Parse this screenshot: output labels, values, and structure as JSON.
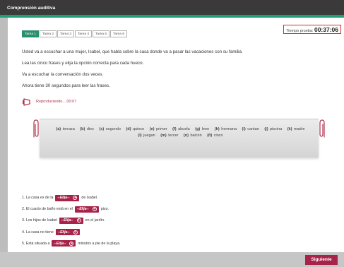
{
  "window": {
    "title": "Comprensión auditiva"
  },
  "tabs": [
    "Tarea 1",
    "Tarea 2",
    "Tarea 3",
    "Tarea 4",
    "Tarea 5",
    "Tarea 6"
  ],
  "active_tab": 0,
  "timer": {
    "label": "Tiempo prueba:",
    "value": "00:37:06"
  },
  "instructions": [
    "Usted va a escuchar a una mujer, Isabel, que habla sobre la casa donde va a pasar las vacaciones con su familia.",
    "Lea las cinco frases y elija la opción correcta para cada hueco.",
    "Va a escuchar la conversación dos veces.",
    "Ahora tiene 30 segundos para leer las frases."
  ],
  "player": {
    "status": "Reproduciendo... 00:07",
    "icon": "speaker-icon"
  },
  "word_bank": {
    "row1": [
      {
        "letter": "(a)",
        "word": "terraza"
      },
      {
        "letter": "(b)",
        "word": "diez"
      },
      {
        "letter": "(c)",
        "word": "segundo"
      },
      {
        "letter": "(d)",
        "word": "quince"
      },
      {
        "letter": "(e)",
        "word": "primer"
      },
      {
        "letter": "(f)",
        "word": "abuela"
      },
      {
        "letter": "(g)",
        "word": "leen"
      },
      {
        "letter": "(h)",
        "word": "hermana"
      },
      {
        "letter": "(i)",
        "word": "cantan"
      },
      {
        "letter": "(j)",
        "word": "piscina"
      },
      {
        "letter": "(k)",
        "word": "madre"
      }
    ],
    "row2": [
      {
        "letter": "(l)",
        "word": "juegan"
      },
      {
        "letter": "(m)",
        "word": "tercer"
      },
      {
        "letter": "(n)",
        "word": "balcón"
      },
      {
        "letter": "(ñ)",
        "word": "cinco"
      }
    ]
  },
  "dropdown_label": "--Elija--",
  "sentences": [
    {
      "before": "1. La casa es de la",
      "after": "de Isabel."
    },
    {
      "before": "2. El cuarto de baño está en el",
      "after": "piso."
    },
    {
      "before": "3. Los hijos de Isabel",
      "after": "en el jardín."
    },
    {
      "before": "4. La casa no tiene",
      "after": ""
    },
    {
      "before": "5. Está situada a",
      "after": "minutos a pie de la playa."
    }
  ],
  "footer": {
    "next_label": "Siguiente"
  },
  "colors": {
    "accent_green": "#1f9e78",
    "brand_red": "#a8234a",
    "timer_border": "#c0392b"
  }
}
